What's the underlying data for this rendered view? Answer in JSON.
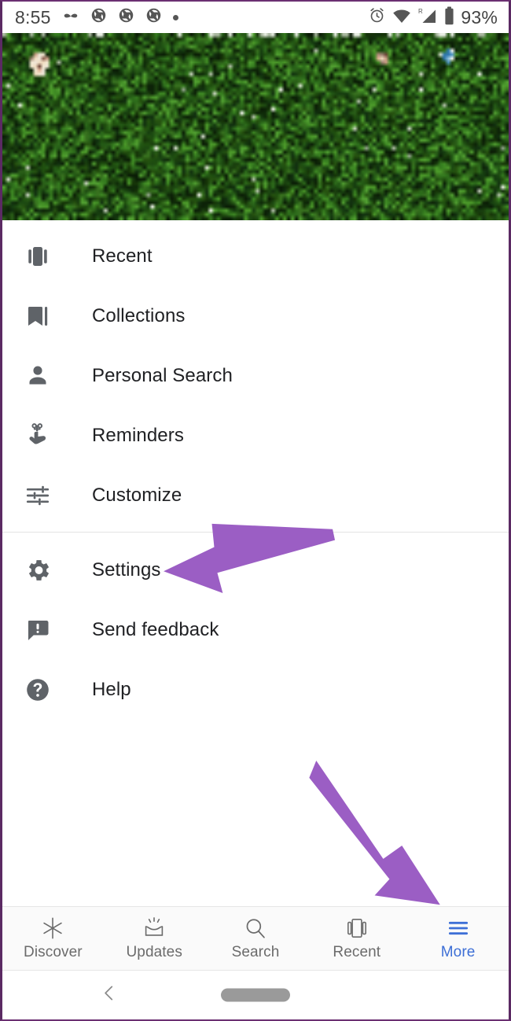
{
  "status_bar": {
    "time": "8:55",
    "battery_percent": "93%",
    "left_icons": [
      "mustache-icon",
      "camera-aperture-icon",
      "camera-aperture-icon",
      "camera-aperture-icon",
      "dot-icon"
    ],
    "right_icons": [
      "alarm-clock-icon",
      "wifi-icon",
      "cellular-signal-roaming-icon",
      "battery-icon"
    ],
    "roaming_label": "R",
    "text_color": "#434343"
  },
  "banner": {
    "name": "profile-cover-photo",
    "description": "pixelated green garden photo"
  },
  "menu": {
    "group_one": [
      {
        "label": "Recent",
        "icon": "cards-carousel-icon"
      },
      {
        "label": "Collections",
        "icon": "bookmark-icon"
      },
      {
        "label": "Personal Search",
        "icon": "person-icon"
      },
      {
        "label": "Reminders",
        "icon": "finger-string-reminder-icon"
      },
      {
        "label": "Customize",
        "icon": "tune-sliders-icon"
      }
    ],
    "group_two": [
      {
        "label": "Settings",
        "icon": "gear-icon"
      },
      {
        "label": "Send feedback",
        "icon": "feedback-icon"
      },
      {
        "label": "Help",
        "icon": "help-circle-icon"
      }
    ]
  },
  "bottom_nav": {
    "items": [
      {
        "label": "Discover",
        "icon": "asterisk-star-icon",
        "active": false
      },
      {
        "label": "Updates",
        "icon": "inbox-rays-icon",
        "active": false
      },
      {
        "label": "Search",
        "icon": "magnifier-icon",
        "active": false
      },
      {
        "label": "Recent",
        "icon": "cards-carousel-icon",
        "active": false
      },
      {
        "label": "More",
        "icon": "hamburger-menu-icon",
        "active": true
      }
    ],
    "active_color": "#3d6fd6",
    "inactive_color": "#6b6b6b"
  },
  "system_nav": {
    "back_icon": "chevron-left-icon",
    "home_icon": "home-pill-icon"
  },
  "annotations": {
    "color": "#9b5ec4",
    "arrows": [
      {
        "name": "arrow-pointing-to-settings",
        "target": "Settings"
      },
      {
        "name": "arrow-pointing-to-more-tab",
        "target": "More"
      }
    ]
  },
  "frame": {
    "border_color": "#5b2a63"
  }
}
